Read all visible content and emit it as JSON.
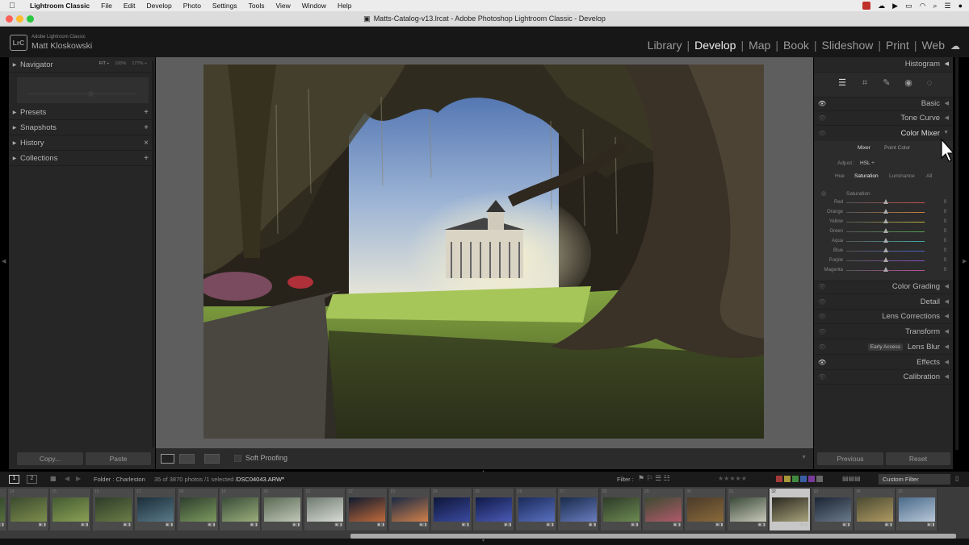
{
  "menubar": {
    "apple_icon": "apple-icon",
    "app_name": "Lightroom Classic",
    "items": [
      "File",
      "Edit",
      "Develop",
      "Photo",
      "Settings",
      "Tools",
      "View",
      "Window",
      "Help"
    ]
  },
  "window": {
    "title": "Matts-Catalog-v13.lrcat - Adobe Photoshop Lightroom Classic - Develop",
    "traffic_light_colors": [
      "#ff5f57",
      "#febc2e",
      "#28c840"
    ]
  },
  "identity": {
    "logo": "LrC",
    "product": "Adobe Lightroom Classic",
    "user": "Matt Kloskowski"
  },
  "modules": [
    "Library",
    "Develop",
    "Map",
    "Book",
    "Slideshow",
    "Print",
    "Web"
  ],
  "active_module": "Develop",
  "left_panel": {
    "navigator": {
      "label": "Navigator",
      "zoom": [
        "FIT ÷",
        "100%",
        "177% ÷"
      ]
    },
    "sections": [
      {
        "label": "Presets",
        "action": "+"
      },
      {
        "label": "Snapshots",
        "action": "+"
      },
      {
        "label": "History",
        "action": "×"
      },
      {
        "label": "Collections",
        "action": "+"
      }
    ],
    "copy_button": "Copy...",
    "paste_button": "Paste"
  },
  "toolbar": {
    "soft_proofing": "Soft Proofing"
  },
  "right_panel": {
    "histogram": "Histogram",
    "panels_top": [
      "Basic",
      "Tone Curve"
    ],
    "color_mixer": {
      "label": "Color Mixer",
      "tabs": [
        "Mixer",
        "Point Color"
      ],
      "adjust_label": "Adjust :",
      "adjust_value": "HSL ÷",
      "hsl_tabs": [
        "Hue",
        "Saturation",
        "Luminance",
        "All"
      ],
      "active_hsl_tab": "Saturation",
      "section_title": "Saturation",
      "sliders": [
        {
          "name": "Red",
          "value": "0",
          "color": "#c85050"
        },
        {
          "name": "Orange",
          "value": "0",
          "color": "#c87f3a"
        },
        {
          "name": "Yellow",
          "value": "0",
          "color": "#bfb23e"
        },
        {
          "name": "Green",
          "value": "0",
          "color": "#4ea24e"
        },
        {
          "name": "Aqua",
          "value": "0",
          "color": "#43a8a8"
        },
        {
          "name": "Blue",
          "value": "0",
          "color": "#4b62c2"
        },
        {
          "name": "Purple",
          "value": "0",
          "color": "#8a4fc0"
        },
        {
          "name": "Magenta",
          "value": "0",
          "color": "#c04fa0"
        }
      ]
    },
    "panels_bottom": [
      {
        "label": "Color Grading",
        "badge": "",
        "eye_on": false
      },
      {
        "label": "Detail",
        "badge": "",
        "eye_on": false
      },
      {
        "label": "Lens Corrections",
        "badge": "",
        "eye_on": false
      },
      {
        "label": "Transform",
        "badge": "",
        "eye_on": false
      },
      {
        "label": "Lens Blur",
        "badge": "Early Access",
        "eye_on": false
      },
      {
        "label": "Effects",
        "badge": "",
        "eye_on": true
      },
      {
        "label": "Calibration",
        "badge": "",
        "eye_on": false
      }
    ],
    "previous_button": "Previous",
    "reset_button": "Reset"
  },
  "filmstrip_bar": {
    "screens": [
      "1",
      "2"
    ],
    "source": "Folder : Charleston",
    "count": "35 of 3870 photos /1 selected /",
    "filename": "DSC04043.ARW",
    "filter_label": "Filter :",
    "filter_value": "Custom Filter",
    "label_colors": [
      "#a33a3a",
      "#a6983a",
      "#3f8a3f",
      "#3a5ea3",
      "#7a3a9a",
      "#666666"
    ]
  },
  "filmstrip": {
    "numbers": [
      "",
      "14",
      "15",
      "16",
      "17",
      "18",
      "19",
      "20",
      "21",
      "22",
      "23",
      "24",
      "25",
      "26",
      "27",
      "28",
      "29",
      "30",
      "31",
      "32",
      "33",
      "34",
      "35"
    ],
    "selected_index": 19
  }
}
